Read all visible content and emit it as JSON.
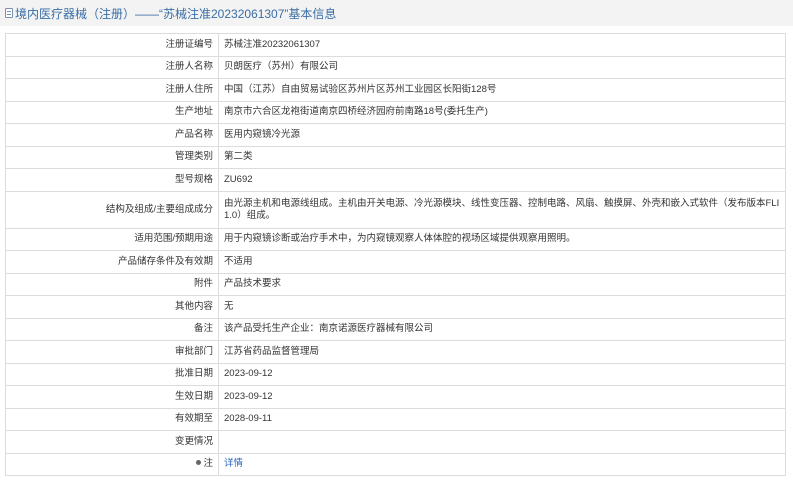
{
  "header": {
    "title": "境内医疗器械（注册）——“苏械注准20232061307”基本信息"
  },
  "rows": [
    {
      "label": "注册证编号",
      "value": "苏械注准20232061307"
    },
    {
      "label": "注册人名称",
      "value": "贝朗医疗（苏州）有限公司"
    },
    {
      "label": "注册人住所",
      "value": "中国（江苏）自由贸易试验区苏州片区苏州工业园区长阳街128号"
    },
    {
      "label": "生产地址",
      "value": "南京市六合区龙袍街道南京四桥经济园府前南路18号(委托生产)"
    },
    {
      "label": "产品名称",
      "value": "医用内窥镜冷光源"
    },
    {
      "label": "管理类别",
      "value": "第二类"
    },
    {
      "label": "型号规格",
      "value": "ZU692"
    },
    {
      "label": "结构及组成/主要组成成分",
      "value": "由光源主机和电源线组成。主机由开关电源、冷光源模块、线性变压器、控制电路、风扇、触摸屏、外壳和嵌入式软件（发布版本FLI 1.0）组成。"
    },
    {
      "label": "适用范围/预期用途",
      "value": "用于内窥镜诊断或治疗手术中，为内窥镜观察人体体腔的视场区域提供观察用照明。"
    },
    {
      "label": "产品储存条件及有效期",
      "value": "不适用"
    },
    {
      "label": "附件",
      "value": "产品技术要求"
    },
    {
      "label": "其他内容",
      "value": "无"
    },
    {
      "label": "备注",
      "value": "该产品受托生产企业：南京诺源医疗器械有限公司"
    },
    {
      "label": "审批部门",
      "value": "江苏省药品监督管理局"
    },
    {
      "label": "批准日期",
      "value": "2023-09-12"
    },
    {
      "label": "生效日期",
      "value": "2023-09-12"
    },
    {
      "label": "有效期至",
      "value": "2028-09-11"
    },
    {
      "label": "变更情况",
      "value": ""
    }
  ],
  "note": {
    "label": "注",
    "link_text": "详情"
  }
}
